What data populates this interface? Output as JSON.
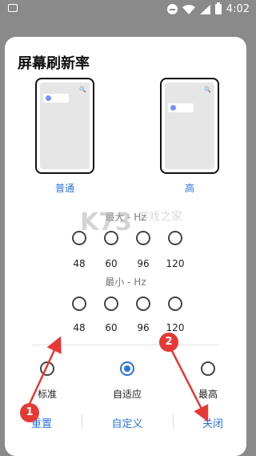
{
  "status_bar": {
    "time": "4:02",
    "icons": [
      "image-icon",
      "dnd-icon",
      "wifi-icon",
      "signal-icon",
      "battery-icon"
    ]
  },
  "dialog": {
    "title": "屏幕刷新率",
    "previews": [
      {
        "label": "普通"
      },
      {
        "label": "高"
      }
    ],
    "max_section": {
      "label": "最大 - Hz",
      "options": [
        "48",
        "60",
        "96",
        "120"
      ]
    },
    "min_section": {
      "label": "最小 - Hz",
      "options": [
        "48",
        "60",
        "96",
        "120"
      ]
    },
    "modes": [
      {
        "label": "标准",
        "selected": false
      },
      {
        "label": "自适应",
        "selected": true
      },
      {
        "label": "最高",
        "selected": false
      }
    ],
    "footer": {
      "reset": "重置",
      "custom": "自定义",
      "close": "关闭"
    }
  },
  "annotations": {
    "marker1": "1",
    "marker2": "2",
    "color": "#e53935"
  },
  "colors": {
    "accent": "#2a73d9",
    "backdrop": "#8a8a8a"
  }
}
